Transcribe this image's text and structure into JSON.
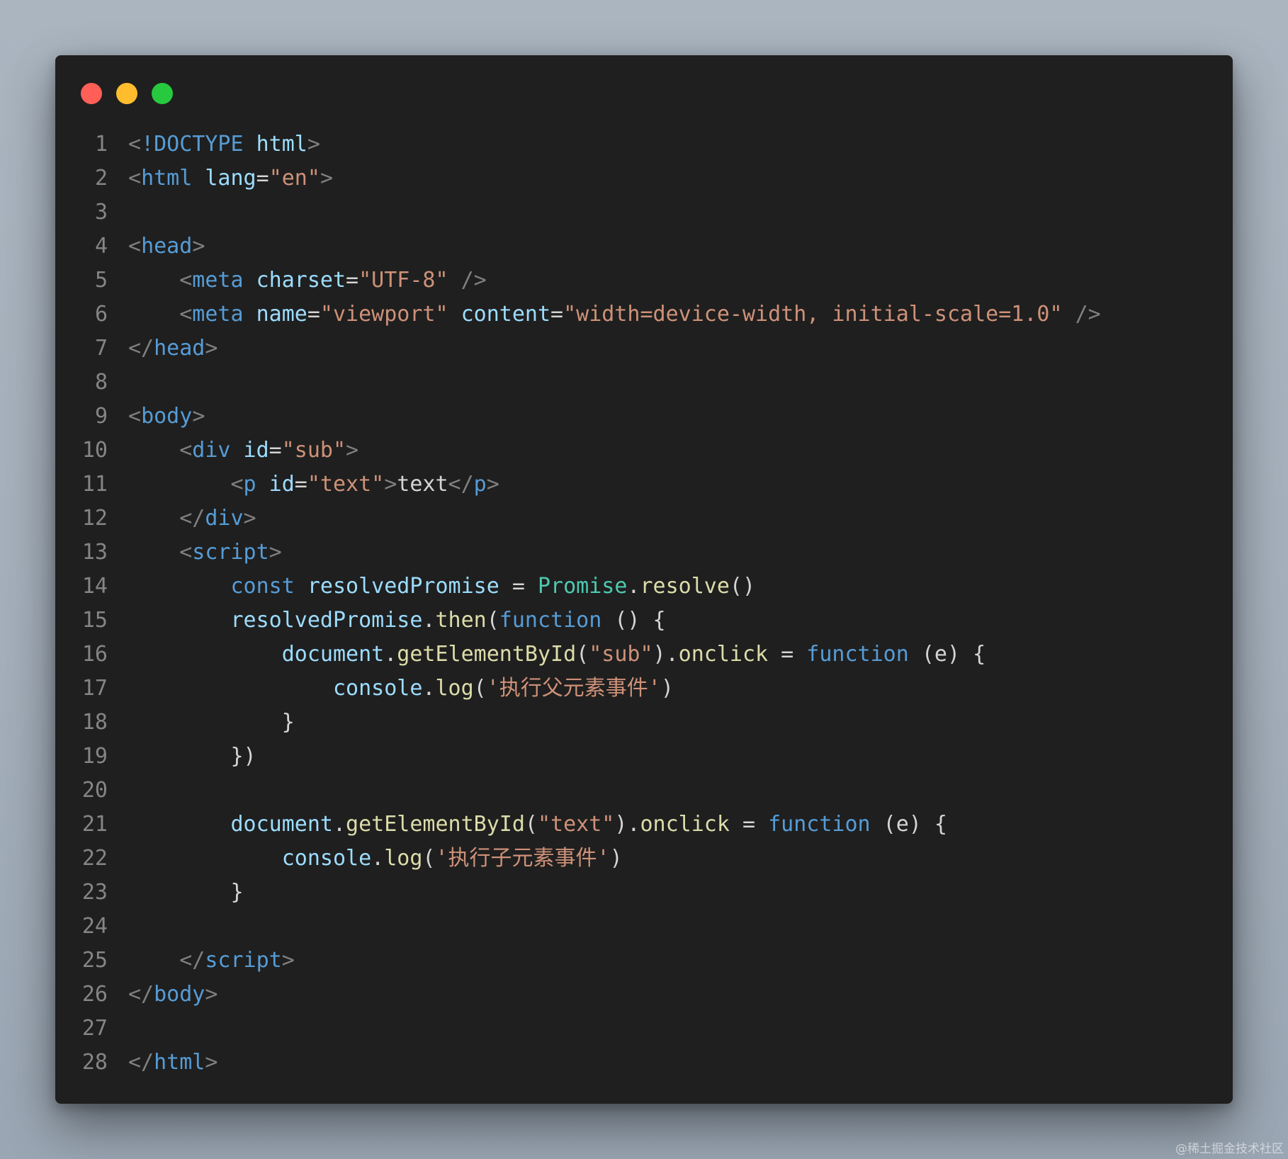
{
  "colors": {
    "punct": "#808080",
    "tag": "#569cd6",
    "attr": "#9cdcfe",
    "string": "#ce9178",
    "text": "#d4d4d4",
    "keyword": "#569cd6",
    "variable": "#9cdcfe",
    "function": "#dcdcaa",
    "class": "#4ec9b0",
    "dot_red": "#ff5f56",
    "dot_yellow": "#ffbd2e",
    "dot_green": "#27c93f"
  },
  "window": {
    "controls": [
      "close-dot",
      "minimize-dot",
      "maximize-dot"
    ]
  },
  "code_lines": [
    {
      "n": "1",
      "indent": 0,
      "tokens": [
        [
          "<",
          "punct"
        ],
        [
          "!DOCTYPE",
          "tag"
        ],
        [
          " ",
          "text"
        ],
        [
          "html",
          "attr"
        ],
        [
          ">",
          "punct"
        ]
      ]
    },
    {
      "n": "2",
      "indent": 0,
      "tokens": [
        [
          "<",
          "punct"
        ],
        [
          "html",
          "tag"
        ],
        [
          " ",
          "text"
        ],
        [
          "lang",
          "attr"
        ],
        [
          "=",
          "text"
        ],
        [
          "\"en\"",
          "string"
        ],
        [
          ">",
          "punct"
        ]
      ]
    },
    {
      "n": "3",
      "indent": 0,
      "tokens": []
    },
    {
      "n": "4",
      "indent": 0,
      "tokens": [
        [
          "<",
          "punct"
        ],
        [
          "head",
          "tag"
        ],
        [
          ">",
          "punct"
        ]
      ]
    },
    {
      "n": "5",
      "indent": 4,
      "tokens": [
        [
          "<",
          "punct"
        ],
        [
          "meta",
          "tag"
        ],
        [
          " ",
          "text"
        ],
        [
          "charset",
          "attr"
        ],
        [
          "=",
          "text"
        ],
        [
          "\"UTF-8\"",
          "string"
        ],
        [
          " ",
          "text"
        ],
        [
          "/>",
          "punct"
        ]
      ]
    },
    {
      "n": "6",
      "indent": 4,
      "tokens": [
        [
          "<",
          "punct"
        ],
        [
          "meta",
          "tag"
        ],
        [
          " ",
          "text"
        ],
        [
          "name",
          "attr"
        ],
        [
          "=",
          "text"
        ],
        [
          "\"viewport\"",
          "string"
        ],
        [
          " ",
          "text"
        ],
        [
          "content",
          "attr"
        ],
        [
          "=",
          "text"
        ],
        [
          "\"width=device-width, initial-scale=1.0\"",
          "string"
        ],
        [
          " ",
          "text"
        ],
        [
          "/>",
          "punct"
        ]
      ]
    },
    {
      "n": "7",
      "indent": 0,
      "tokens": [
        [
          "</",
          "punct"
        ],
        [
          "head",
          "tag"
        ],
        [
          ">",
          "punct"
        ]
      ]
    },
    {
      "n": "8",
      "indent": 0,
      "tokens": []
    },
    {
      "n": "9",
      "indent": 0,
      "tokens": [
        [
          "<",
          "punct"
        ],
        [
          "body",
          "tag"
        ],
        [
          ">",
          "punct"
        ]
      ]
    },
    {
      "n": "10",
      "indent": 4,
      "tokens": [
        [
          "<",
          "punct"
        ],
        [
          "div",
          "tag"
        ],
        [
          " ",
          "text"
        ],
        [
          "id",
          "attr"
        ],
        [
          "=",
          "text"
        ],
        [
          "\"sub\"",
          "string"
        ],
        [
          ">",
          "punct"
        ]
      ]
    },
    {
      "n": "11",
      "indent": 8,
      "tokens": [
        [
          "<",
          "punct"
        ],
        [
          "p",
          "tag"
        ],
        [
          " ",
          "text"
        ],
        [
          "id",
          "attr"
        ],
        [
          "=",
          "text"
        ],
        [
          "\"text\"",
          "string"
        ],
        [
          ">",
          "punct"
        ],
        [
          "text",
          "text"
        ],
        [
          "</",
          "punct"
        ],
        [
          "p",
          "tag"
        ],
        [
          ">",
          "punct"
        ]
      ]
    },
    {
      "n": "12",
      "indent": 4,
      "tokens": [
        [
          "</",
          "punct"
        ],
        [
          "div",
          "tag"
        ],
        [
          ">",
          "punct"
        ]
      ]
    },
    {
      "n": "13",
      "indent": 4,
      "tokens": [
        [
          "<",
          "punct"
        ],
        [
          "script",
          "tag"
        ],
        [
          ">",
          "punct"
        ]
      ]
    },
    {
      "n": "14",
      "indent": 8,
      "tokens": [
        [
          "const",
          "keyword"
        ],
        [
          " ",
          "text"
        ],
        [
          "resolvedPromise",
          "variable"
        ],
        [
          " = ",
          "text"
        ],
        [
          "Promise",
          "class"
        ],
        [
          ".",
          "text"
        ],
        [
          "resolve",
          "function"
        ],
        [
          "()",
          "text"
        ]
      ]
    },
    {
      "n": "15",
      "indent": 8,
      "tokens": [
        [
          "resolvedPromise",
          "variable"
        ],
        [
          ".",
          "text"
        ],
        [
          "then",
          "function"
        ],
        [
          "(",
          "text"
        ],
        [
          "function",
          "keyword"
        ],
        [
          " () {",
          "text"
        ]
      ]
    },
    {
      "n": "16",
      "indent": 12,
      "tokens": [
        [
          "document",
          "variable"
        ],
        [
          ".",
          "text"
        ],
        [
          "getElementById",
          "function"
        ],
        [
          "(",
          "text"
        ],
        [
          "\"sub\"",
          "string"
        ],
        [
          ").",
          "text"
        ],
        [
          "onclick",
          "function"
        ],
        [
          " = ",
          "text"
        ],
        [
          "function",
          "keyword"
        ],
        [
          " (e) {",
          "text"
        ]
      ]
    },
    {
      "n": "17",
      "indent": 16,
      "tokens": [
        [
          "console",
          "variable"
        ],
        [
          ".",
          "text"
        ],
        [
          "log",
          "function"
        ],
        [
          "(",
          "text"
        ],
        [
          "'执行父元素事件'",
          "string"
        ],
        [
          ")",
          "text"
        ]
      ]
    },
    {
      "n": "18",
      "indent": 12,
      "tokens": [
        [
          "}",
          "text"
        ]
      ]
    },
    {
      "n": "19",
      "indent": 8,
      "tokens": [
        [
          "})",
          "text"
        ]
      ]
    },
    {
      "n": "20",
      "indent": 0,
      "tokens": []
    },
    {
      "n": "21",
      "indent": 8,
      "tokens": [
        [
          "document",
          "variable"
        ],
        [
          ".",
          "text"
        ],
        [
          "getElementById",
          "function"
        ],
        [
          "(",
          "text"
        ],
        [
          "\"text\"",
          "string"
        ],
        [
          ").",
          "text"
        ],
        [
          "onclick",
          "function"
        ],
        [
          " = ",
          "text"
        ],
        [
          "function",
          "keyword"
        ],
        [
          " (e) {",
          "text"
        ]
      ]
    },
    {
      "n": "22",
      "indent": 12,
      "tokens": [
        [
          "console",
          "variable"
        ],
        [
          ".",
          "text"
        ],
        [
          "log",
          "function"
        ],
        [
          "(",
          "text"
        ],
        [
          "'执行子元素事件'",
          "string"
        ],
        [
          ")",
          "text"
        ]
      ]
    },
    {
      "n": "23",
      "indent": 8,
      "tokens": [
        [
          "}",
          "text"
        ]
      ]
    },
    {
      "n": "24",
      "indent": 0,
      "tokens": []
    },
    {
      "n": "25",
      "indent": 4,
      "tokens": [
        [
          "</",
          "punct"
        ],
        [
          "script",
          "tag"
        ],
        [
          ">",
          "punct"
        ]
      ]
    },
    {
      "n": "26",
      "indent": 0,
      "tokens": [
        [
          "</",
          "punct"
        ],
        [
          "body",
          "tag"
        ],
        [
          ">",
          "punct"
        ]
      ]
    },
    {
      "n": "27",
      "indent": 0,
      "tokens": []
    },
    {
      "n": "28",
      "indent": 0,
      "tokens": [
        [
          "</",
          "punct"
        ],
        [
          "html",
          "tag"
        ],
        [
          ">",
          "punct"
        ]
      ]
    }
  ],
  "watermark": "@稀土掘金技术社区"
}
